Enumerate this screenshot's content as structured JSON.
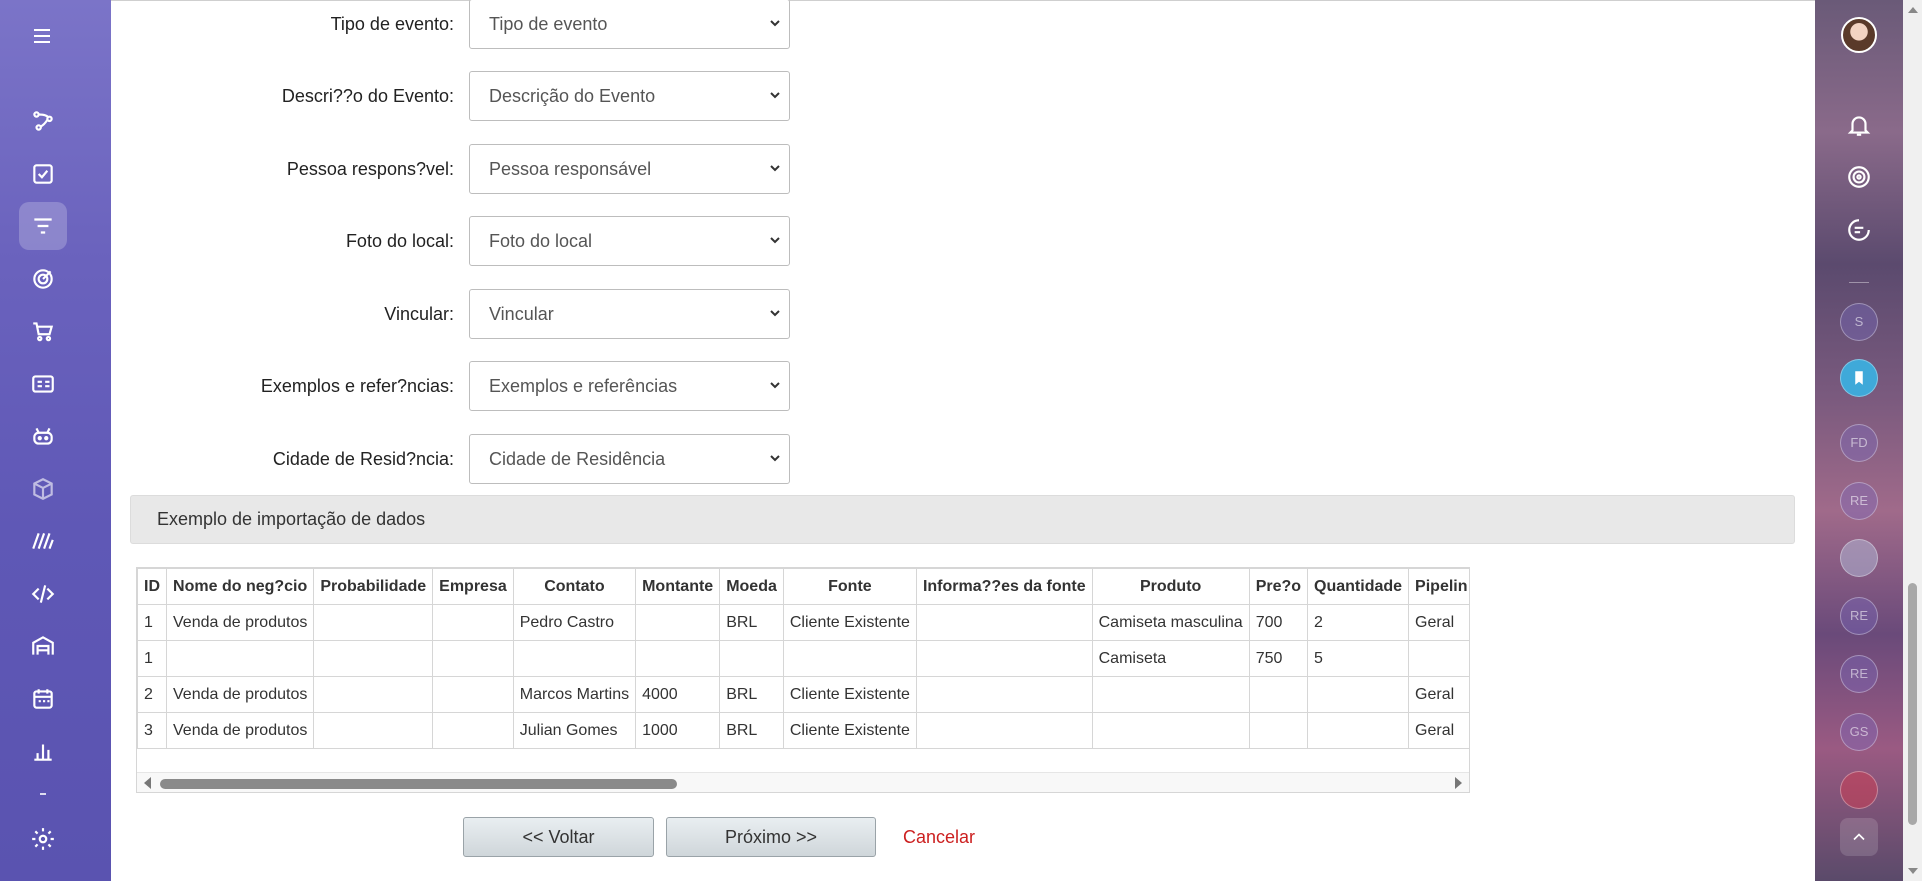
{
  "sidebar": {
    "items": [
      {
        "name": "sidebar-item-crm",
        "icon": "crm-icon"
      },
      {
        "name": "sidebar-item-tasks",
        "icon": "checkbox-icon"
      },
      {
        "name": "sidebar-item-feed",
        "icon": "filter-icon",
        "active": true
      },
      {
        "name": "sidebar-item-goals",
        "icon": "target-icon"
      },
      {
        "name": "sidebar-item-shop",
        "icon": "cart-icon"
      },
      {
        "name": "sidebar-item-contacts",
        "icon": "id-card-icon"
      },
      {
        "name": "sidebar-item-robot",
        "icon": "robot-icon"
      },
      {
        "name": "sidebar-item-box",
        "icon": "cube-icon"
      },
      {
        "name": "sidebar-item-sign",
        "icon": "signature-icon"
      },
      {
        "name": "sidebar-item-dev",
        "icon": "code-icon"
      },
      {
        "name": "sidebar-item-warehouse",
        "icon": "warehouse-icon"
      },
      {
        "name": "sidebar-item-calendar",
        "icon": "calendar-icon"
      },
      {
        "name": "sidebar-item-reports",
        "icon": "bar-chart-icon"
      },
      {
        "name": "sidebar-item-settings",
        "icon": "gear-icon"
      }
    ]
  },
  "form": {
    "fields": [
      {
        "label": "Tipo de evento:",
        "value": "Tipo de evento"
      },
      {
        "label": "Descri??o do Evento:",
        "value": "Descrição do Evento"
      },
      {
        "label": "Pessoa respons?vel:",
        "value": "Pessoa responsável"
      },
      {
        "label": "Foto do local:",
        "value": "Foto do local"
      },
      {
        "label": "Vincular:",
        "value": "Vincular"
      },
      {
        "label": "Exemplos e refer?ncias:",
        "value": "Exemplos e referências"
      },
      {
        "label": "Cidade de Resid?ncia:",
        "value": "Cidade de Residência"
      }
    ]
  },
  "panel": {
    "title": "Exemplo de importação de dados"
  },
  "table": {
    "headers": [
      "ID",
      "Nome do neg?cio",
      "Probabilidade",
      "Empresa",
      "Contato",
      "Montante",
      "Moeda",
      "Fonte",
      "Informa??es da fonte",
      "Produto",
      "Pre?o",
      "Quantidade",
      "Pipelin"
    ],
    "rows": [
      [
        "1",
        "Venda de produtos",
        "",
        "",
        "Pedro Castro",
        "",
        "BRL",
        "Cliente Existente",
        "",
        "Camiseta masculina",
        "700",
        "2",
        "Geral"
      ],
      [
        "1",
        "",
        "",
        "",
        "",
        "",
        "",
        "",
        "",
        "Camiseta",
        "750",
        "5",
        ""
      ],
      [
        "2",
        "Venda de produtos",
        "",
        "",
        "Marcos Martins",
        "4000",
        "BRL",
        "Cliente Existente",
        "",
        "",
        "",
        "",
        "Geral"
      ],
      [
        "3",
        "Venda de produtos",
        "",
        "",
        "Julian Gomes",
        "1000",
        "BRL",
        "Cliente Existente",
        "",
        "",
        "",
        "",
        "Geral"
      ]
    ]
  },
  "buttons": {
    "back": "<< Voltar",
    "next": "Próximo >>",
    "cancel": "Cancelar"
  },
  "right_panel": {
    "circles": [
      "S",
      "",
      "FD",
      "RE",
      "",
      "RE",
      "RE",
      "GS",
      ""
    ]
  },
  "colors": {
    "sidebar": "#6a62bd",
    "cancel": "#cc1f1f",
    "panel_bg": "#e8e8e8"
  }
}
